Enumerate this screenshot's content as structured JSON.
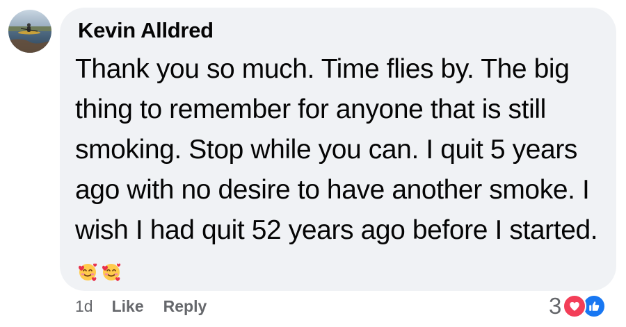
{
  "comment": {
    "author": "Kevin Alldred",
    "text": "Thank you so much. Time flies by. The big thing to remember for anyone that is still smoking. Stop while you can. I quit 5 years ago with no desire to have another smoke. I wish I had quit 52 years ago before I started.",
    "emoji": [
      "smiling-face-with-hearts",
      "smiling-face-with-hearts"
    ],
    "timestamp": "1d",
    "like_label": "Like",
    "reply_label": "Reply",
    "reaction_count": "3",
    "reaction_types": [
      "love",
      "like"
    ]
  },
  "colors": {
    "bubble": "#f0f2f5",
    "text": "#050505",
    "secondary": "#65676b",
    "love": "#f33e58",
    "like": "#1877f2"
  }
}
